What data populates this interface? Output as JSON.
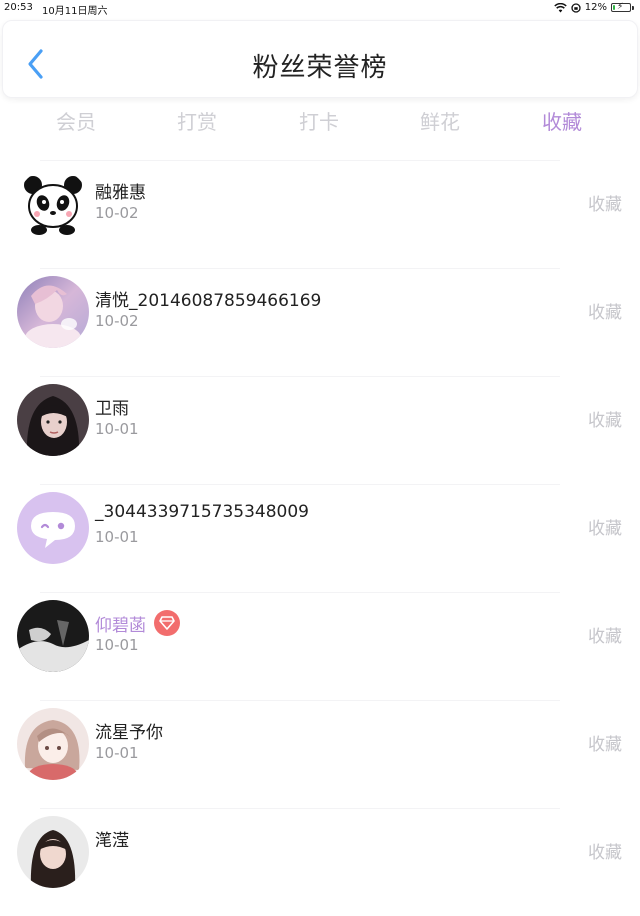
{
  "status_bar": {
    "time": "20:53",
    "date": "10月11日周六",
    "battery": "12%",
    "battery_level": 0.12
  },
  "nav": {
    "title": "粉丝荣誉榜"
  },
  "tabs": [
    {
      "label": "会员"
    },
    {
      "label": "打赏"
    },
    {
      "label": "打卡"
    },
    {
      "label": "鲜花"
    },
    {
      "label": "收藏",
      "active": true
    }
  ],
  "colors": {
    "accent": "#b28ad8",
    "badge": "#f26d6d",
    "muted": "#c6c6cb"
  },
  "list": [
    {
      "name": "融雅惠",
      "date": "10-02",
      "action": "收藏",
      "avatar": "panda-avatar"
    },
    {
      "name": "清悦_20146087859466169",
      "date": "10-02",
      "action": "收藏",
      "avatar": "anime-avatar"
    },
    {
      "name": "卫雨",
      "date": "10-01",
      "action": "收藏",
      "avatar": "girl-avatar"
    },
    {
      "name": "_3044339715735348009",
      "date": "10-01",
      "action": "收藏",
      "avatar": "default-chat-avatar"
    },
    {
      "name": "仰碧菡",
      "date": "10-01",
      "action": "收藏",
      "avatar": "bw-avatar",
      "vip": true
    },
    {
      "name": "流星予你",
      "date": "10-01",
      "action": "收藏",
      "avatar": "anime-girl-avatar"
    },
    {
      "name": "滗滢",
      "date": "",
      "action": "收藏",
      "avatar": "photo-avatar"
    }
  ]
}
